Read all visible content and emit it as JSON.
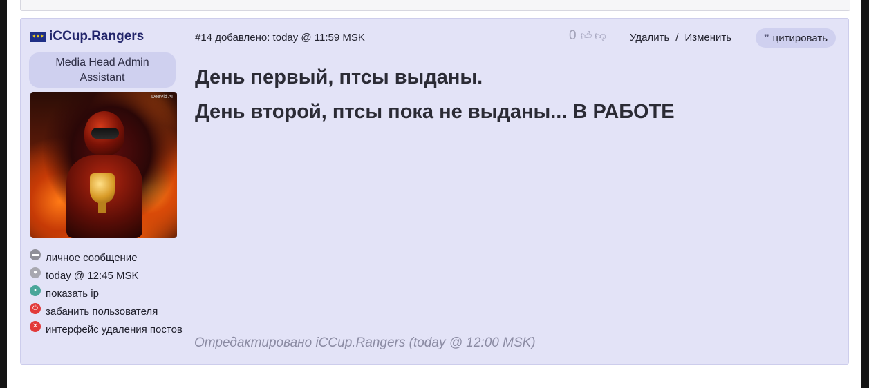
{
  "post": {
    "author": {
      "name": "iCCup.Rangers",
      "flag": "eu-flag",
      "role": "Media Head Admin Assistant",
      "avatar_watermark": "DeeVid AI"
    },
    "meta": "#14 добавлено: today @ 11:59 MSK",
    "votes": {
      "count": "0",
      "up_icon": "thumbs-up-icon",
      "down_icon": "thumbs-down-icon"
    },
    "actions": {
      "delete": "Удалить",
      "separator": "/",
      "edit": "Изменить"
    },
    "quote_label": "цитировать",
    "content": [
      "День первый, птсы выданы.",
      "День второй, птсы пока не выданы... В РАБОТЕ"
    ],
    "edited": "Отредактировано iCCup.Rangers (today @ 12:00 MSK)"
  },
  "user_info": [
    {
      "icon": "message-icon",
      "text": "личное сообщение"
    },
    {
      "icon": "clock-icon",
      "text": "today @ 12:45 MSK"
    },
    {
      "icon": "ip-icon",
      "text": "показать ip"
    },
    {
      "icon": "ban-icon",
      "text": "забанить пользователя"
    },
    {
      "icon": "delete-icon",
      "text": "интерфейс удаления постов"
    }
  ]
}
